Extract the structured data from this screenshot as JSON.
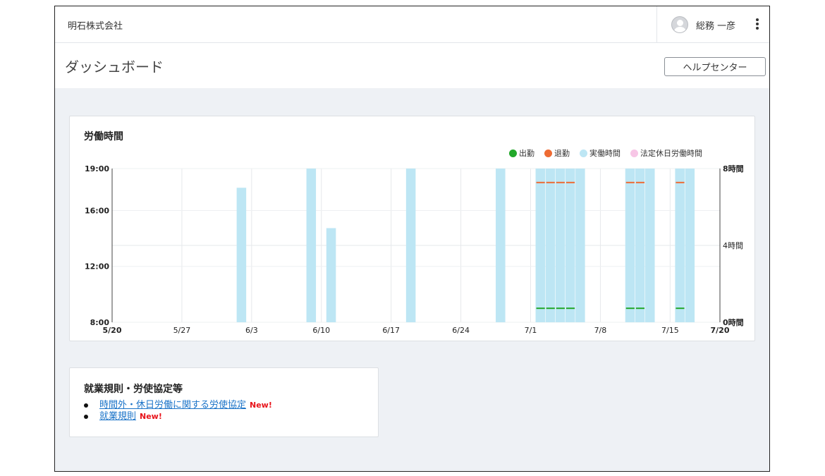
{
  "header": {
    "company": "明石株式会社",
    "user_name": "総務 一彦"
  },
  "page": {
    "title": "ダッシュボード",
    "help_button": "ヘルプセンター"
  },
  "chart_card": {
    "title": "労働時間"
  },
  "chart_data": {
    "type": "bar",
    "legend": [
      {
        "name": "出勤",
        "color": "#22a82a"
      },
      {
        "name": "退勤",
        "color": "#ee6b33"
      },
      {
        "name": "実働時間",
        "color": "#bde6f4"
      },
      {
        "name": "法定休日労働時間",
        "color": "#f7c6e6"
      }
    ],
    "x_range": [
      "2024-05-20",
      "2024-07-20"
    ],
    "x_ticks": [
      {
        "date": "2024-05-20",
        "label": "5/20"
      },
      {
        "date": "2024-05-27",
        "label": "5/27"
      },
      {
        "date": "2024-06-03",
        "label": "6/3"
      },
      {
        "date": "2024-06-10",
        "label": "6/10"
      },
      {
        "date": "2024-06-17",
        "label": "6/17"
      },
      {
        "date": "2024-06-24",
        "label": "6/24"
      },
      {
        "date": "2024-07-01",
        "label": "7/1"
      },
      {
        "date": "2024-07-08",
        "label": "7/8"
      },
      {
        "date": "2024-07-15",
        "label": "7/15"
      },
      {
        "date": "2024-07-20",
        "label": "7/20"
      }
    ],
    "y_left_ticks": [
      {
        "hour": 19,
        "label": "19:00"
      },
      {
        "hour": 16,
        "label": "16:00"
      },
      {
        "hour": 12,
        "label": "12:00"
      },
      {
        "hour": 8,
        "label": "8:00"
      }
    ],
    "y_right_ticks": [
      {
        "hours": 8,
        "label": "8時間"
      },
      {
        "hours": 4,
        "label": "4時間"
      },
      {
        "hours": 0,
        "label": "0時間"
      }
    ],
    "y_left_range": [
      8,
      19
    ],
    "y_right_range": [
      0,
      8
    ],
    "work_hours": [
      {
        "date": "2024-06-02",
        "hours": 7.0
      },
      {
        "date": "2024-06-09",
        "hours": 8.0
      },
      {
        "date": "2024-06-11",
        "hours": 4.9
      },
      {
        "date": "2024-06-19",
        "hours": 8.0
      },
      {
        "date": "2024-06-28",
        "hours": 8.0
      },
      {
        "date": "2024-07-02",
        "hours": 8.0
      },
      {
        "date": "2024-07-03",
        "hours": 8.0
      },
      {
        "date": "2024-07-04",
        "hours": 8.0
      },
      {
        "date": "2024-07-05",
        "hours": 8.0
      },
      {
        "date": "2024-07-06",
        "hours": 8.0
      },
      {
        "date": "2024-07-11",
        "hours": 8.0
      },
      {
        "date": "2024-07-12",
        "hours": 8.0
      },
      {
        "date": "2024-07-13",
        "hours": 8.0
      },
      {
        "date": "2024-07-16",
        "hours": 8.0
      },
      {
        "date": "2024-07-17",
        "hours": 8.0
      }
    ],
    "clock_in_hour": 9.0,
    "clock_out_hour": 18.0,
    "attendance_days": [
      "2024-07-02",
      "2024-07-03",
      "2024-07-04",
      "2024-07-05",
      "2024-07-11",
      "2024-07-12",
      "2024-07-16"
    ]
  },
  "rules_card": {
    "title": "就業規則・労使協定等",
    "items": [
      {
        "label": "時間外・休日労働に関する労使協定",
        "badge": "New!"
      },
      {
        "label": "就業規則",
        "badge": "New!"
      }
    ]
  },
  "colors": {
    "accent_link": "#1a73c8",
    "new_badge": "#e8131a",
    "page_background": "#eef1f5"
  }
}
